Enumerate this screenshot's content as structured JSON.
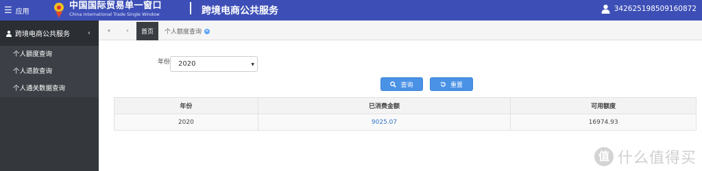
{
  "header": {
    "menu_label": "应用",
    "brand_cn": "中国国际贸易单一窗口",
    "brand_en": "China International Trade Single Window",
    "service_title": "跨境电商公共服务",
    "user_id": "342625198509160872",
    "bg_color": "#3d4fb6"
  },
  "sidebar": {
    "title": "跨境电商公共服务",
    "collapse_icon": "chevron-left-icon",
    "items": [
      {
        "label": "个人额度查询"
      },
      {
        "label": "个人退款查询"
      },
      {
        "label": "个人通关数据查询"
      }
    ]
  },
  "tabs": {
    "back_icon": "double-left-icon",
    "prev_icon": "left-icon",
    "home_label": "首页",
    "open_tab_label": "个人额度查询"
  },
  "form": {
    "year_label": "年份",
    "year_value": "2020",
    "query_label": "查询",
    "reset_label": "重置"
  },
  "table": {
    "headers": [
      "年份",
      "已消费金额",
      "可用额度"
    ],
    "rows": [
      [
        "2020",
        "9025.07",
        "16974.93"
      ]
    ]
  },
  "watermark": {
    "logo_char": "值",
    "text": "什么值得买"
  }
}
